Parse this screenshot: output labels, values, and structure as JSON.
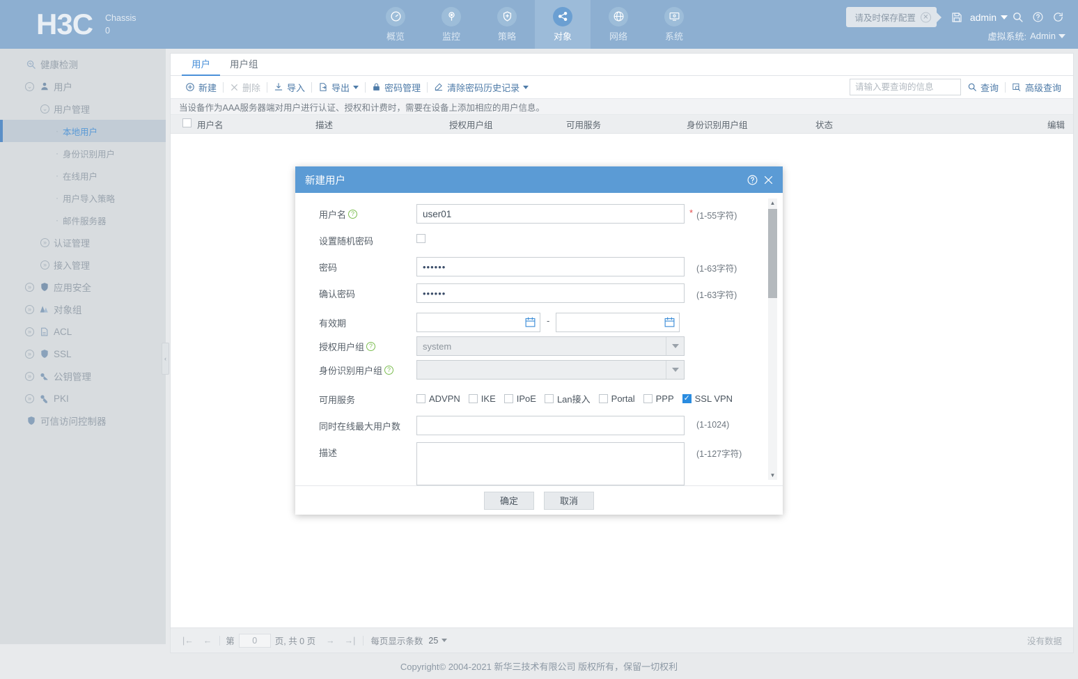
{
  "header": {
    "logo": "H3C",
    "chassis_label": "Chassis",
    "chassis_value": "0",
    "nav": [
      {
        "label": "概览",
        "icon": "dashboard-icon",
        "active": false
      },
      {
        "label": "监控",
        "icon": "monitor-icon",
        "active": false
      },
      {
        "label": "策略",
        "icon": "shield-plus-icon",
        "active": false
      },
      {
        "label": "对象",
        "icon": "share-nodes-icon",
        "active": true
      },
      {
        "label": "网络",
        "icon": "globe-icon",
        "active": false
      },
      {
        "label": "系统",
        "icon": "system-gear-icon",
        "active": false
      }
    ],
    "save_tip": "请及时保存配置",
    "admin": "admin",
    "vsys_label": "虚拟系统:",
    "vsys_value": "Admin"
  },
  "sidebar": {
    "items": [
      {
        "label": "健康检测",
        "level": 1,
        "expander": "",
        "icon": "health-check-icon",
        "active": false
      },
      {
        "label": "用户",
        "level": 1,
        "expander": "▼",
        "icon": "user-icon",
        "active": false
      },
      {
        "label": "用户管理",
        "level": 2,
        "expander": "▼",
        "icon": "",
        "active": false
      },
      {
        "label": "本地用户",
        "level": 3,
        "expander": "",
        "icon": "",
        "active": true
      },
      {
        "label": "身份识别用户",
        "level": 3,
        "expander": "",
        "icon": "",
        "active": false
      },
      {
        "label": "在线用户",
        "level": 3,
        "expander": "",
        "icon": "",
        "active": false
      },
      {
        "label": "用户导入策略",
        "level": 3,
        "expander": "",
        "icon": "",
        "active": false
      },
      {
        "label": "邮件服务器",
        "level": 3,
        "expander": "",
        "icon": "",
        "active": false
      },
      {
        "label": "认证管理",
        "level": 2,
        "expander": "»",
        "icon": "",
        "active": false
      },
      {
        "label": "接入管理",
        "level": 2,
        "expander": "»",
        "icon": "",
        "active": false
      },
      {
        "label": "应用安全",
        "level": 1,
        "expander": "»",
        "icon": "app-security-icon",
        "active": false
      },
      {
        "label": "对象组",
        "level": 1,
        "expander": "»",
        "icon": "object-group-icon",
        "active": false
      },
      {
        "label": "ACL",
        "level": 1,
        "expander": "»",
        "icon": "acl-icon",
        "active": false
      },
      {
        "label": "SSL",
        "level": 1,
        "expander": "»",
        "icon": "ssl-shield-icon",
        "active": false
      },
      {
        "label": "公钥管理",
        "level": 1,
        "expander": "»",
        "icon": "public-key-icon",
        "active": false
      },
      {
        "label": "PKI",
        "level": 1,
        "expander": "»",
        "icon": "pki-key-icon",
        "active": false
      },
      {
        "label": "可信访问控制器",
        "level": 1,
        "expander": "",
        "icon": "trusted-access-icon",
        "active": false
      }
    ]
  },
  "main": {
    "tabs": [
      {
        "label": "用户",
        "active": true
      },
      {
        "label": "用户组",
        "active": false
      }
    ],
    "toolbar": {
      "new": "新建",
      "delete": "删除",
      "import": "导入",
      "export": "导出",
      "password_mgmt": "密码管理",
      "clear_history": "清除密码历史记录"
    },
    "search": {
      "placeholder": "请输入要查询的信息",
      "query": "查询",
      "advanced_query": "高级查询"
    },
    "hint": "当设备作为AAA服务器端对用户进行认证、授权和计费时，需要在设备上添加相应的用户信息。",
    "columns": [
      "用户名",
      "描述",
      "授权用户组",
      "可用服务",
      "身份识别用户组",
      "状态",
      "编辑"
    ],
    "rows": [],
    "pager": {
      "page_prefix": "第",
      "page_value": "0",
      "page_suffix": "页, 共 0 页",
      "per_page_label": "每页显示条数",
      "per_page_value": "25",
      "no_data": "没有数据"
    }
  },
  "modal": {
    "title": "新建用户",
    "username_label": "用户名",
    "username_value": "user01",
    "username_hint": "(1-55字符)",
    "random_pw_label": "设置随机密码",
    "random_pw_checked": false,
    "password_label": "密码",
    "password_value": "••••••",
    "password_hint": "(1-63字符)",
    "confirm_label": "确认密码",
    "confirm_value": "••••••",
    "confirm_hint": "(1-63字符)",
    "validity_label": "有效期",
    "validity_start": "",
    "validity_end": "",
    "auth_group_label": "授权用户组",
    "auth_group_value": "system",
    "identity_group_label": "身份识别用户组",
    "identity_group_value": "",
    "services_label": "可用服务",
    "services": [
      {
        "label": "ADVPN",
        "checked": false
      },
      {
        "label": "IKE",
        "checked": false
      },
      {
        "label": "IPoE",
        "checked": false
      },
      {
        "label": "Lan接入",
        "checked": false
      },
      {
        "label": "Portal",
        "checked": false
      },
      {
        "label": "PPP",
        "checked": false
      },
      {
        "label": "SSL VPN",
        "checked": true
      }
    ],
    "max_online_label": "同时在线最大用户数",
    "max_online_value": "",
    "max_online_hint": "(1-1024)",
    "desc_label": "描述",
    "desc_value": "",
    "desc_hint": "(1-127字符)",
    "ok": "确定",
    "cancel": "取消"
  },
  "footer": {
    "copyright": "Copyright© 2004-2021 新华三技术有限公司 版权所有，保留一切权利"
  },
  "colors": {
    "header_blue": "#8dafd1",
    "accent_blue": "#4a90d9",
    "modal_head": "#5b9bd5",
    "checked_blue": "#2a8ce0",
    "required_red": "#e34a4a"
  }
}
